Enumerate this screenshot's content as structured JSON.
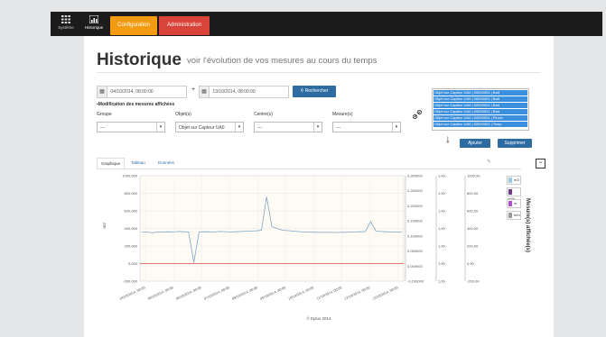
{
  "nav": {
    "tiles": [
      {
        "label": "Système",
        "icon": "grid-icon"
      },
      {
        "label": "Historique",
        "icon": "chart-icon"
      }
    ],
    "tabs": [
      {
        "label": "Configuration",
        "color": "#f39c12"
      },
      {
        "label": "Administration",
        "color": "#d9433a"
      }
    ]
  },
  "page": {
    "title": "Historique",
    "subtitle": "voir l'évolution de vos mesures au cours du temps"
  },
  "filters": {
    "date_from": "04/10/2014, 08:00:00",
    "date_to": "13/10/2014, 08:00:00",
    "search_label": "Rechercher",
    "modify_label": "Modification des mesures affichées",
    "groupe_label": "Groupe",
    "objet_label": "Objet(s)",
    "centre_label": "Centre(s)",
    "mesure_label": "Mesure(s)",
    "groupe_value": "---",
    "objet_value": "Objet sur Capteur UA0",
    "centre_value": "---",
    "mesure_value": "---",
    "selected_list": [
      "Objet sur Capteur UA0 | 00000001 | Batt",
      "Objet sur Capteur UA0 | 00000001 | Batt",
      "Objet sur Capteur UA0 | 00000001 | Batt",
      "Objet sur Capteur UA0 | 00000001 | Batt",
      "Objet sur Capteur UA0 | 00000001 | Pluvio",
      "Objet sur Capteur UA0 | 00000001 | Temp"
    ],
    "add_label": "Ajouter",
    "remove_label": "Supprimer"
  },
  "view_tabs": [
    "Graphique",
    "Tableau",
    "Données"
  ],
  "side_panel_label": "Mesure(s) affichée(s)",
  "legend_items": [
    {
      "label": "m3",
      "color": "#9ec9e6"
    },
    {
      "label": "m³/h",
      "color": "#6b3d8a"
    },
    {
      "label": "m",
      "color": "#b14ad6"
    },
    {
      "label": "mm",
      "color": "#9a9a9a"
    }
  ],
  "footer": "© Eplus 2014",
  "chart_data": {
    "type": "line",
    "x": [
      "04/10/2014, 00:00",
      "05/10/2014, 00:00",
      "06/10/2014, 00:00",
      "07/10/2014, 00:00",
      "08/10/2014, 00:00",
      "09/10/2014, 00:00",
      "10/10/2014, 00:00",
      "11/10/2014, 00:00",
      "12/10/2014, 00:00",
      "13/10/2014, 00:00"
    ],
    "axes": {
      "left": {
        "ticks": [
          "1000,000",
          "800,000",
          "600,000",
          "400,000",
          "200,000",
          "0,000",
          "-200,000"
        ],
        "label": "m3",
        "ylim": [
          -200,
          1000
        ]
      },
      "right1": {
        "ticks": [
          "0,300000",
          "0,250000",
          "0,200000",
          "0,150000",
          "0,100000",
          "0,050000",
          "0,000000",
          "-0,100000"
        ]
      },
      "right2": {
        "ticks": [
          "1,00",
          "1,00",
          "1,00",
          "1,00",
          "1,00",
          "1,00",
          "1,00"
        ]
      },
      "right3": {
        "ticks": [
          "1000,00",
          "800,00",
          "600,00",
          "400,00",
          "200,00",
          "0,00",
          "-200,00"
        ]
      }
    },
    "series": [
      {
        "values": [
          360,
          360,
          350,
          360,
          358,
          362,
          360,
          365,
          362,
          360,
          10,
          360,
          362,
          361,
          360,
          365,
          363,
          360,
          362,
          365,
          368,
          370,
          372,
          380,
          760,
          420,
          400,
          380,
          375,
          370,
          365,
          360,
          358,
          357,
          355,
          356,
          355,
          354,
          355,
          356,
          358,
          360,
          362,
          365,
          480,
          370,
          365,
          362,
          360,
          360,
          358
        ]
      }
    ],
    "hline": 0,
    "grid": true
  }
}
